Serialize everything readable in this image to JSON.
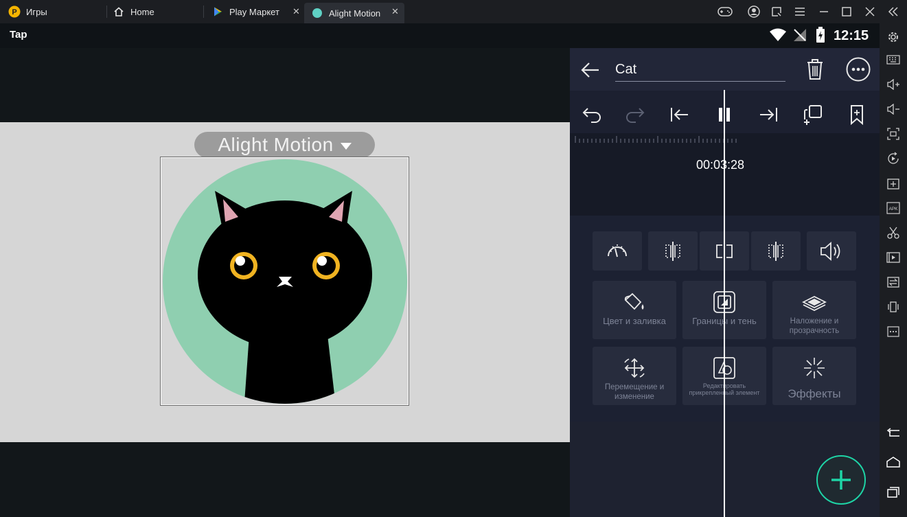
{
  "tabs": [
    {
      "label": "Игры",
      "icon": "game-center-icon"
    },
    {
      "label": "Home",
      "icon": "home-icon"
    },
    {
      "label": "Play Маркет",
      "icon": "play-store-icon"
    },
    {
      "label": "Alight Motion",
      "icon": "alight-motion-icon"
    }
  ],
  "statusbar": {
    "left_label": "Tap",
    "time": "12:15"
  },
  "canvas": {
    "object_label": "Alight Motion"
  },
  "panel": {
    "project_name": "Cat",
    "time_readout": "00:03:28"
  },
  "tools": {
    "color_fill": "Цвет и заливка",
    "border_shadow": "Границы и тень",
    "blending": "Наложение и прозрачность",
    "move_transform": "Перемещение и изменение",
    "edit_attached": "Редактировать прикрепленный элемент",
    "effects": "Эффекты"
  },
  "colors": {
    "accent": "#1ed4a6",
    "clip": "#f06c7c",
    "cat_bg": "#8fcfb0"
  }
}
